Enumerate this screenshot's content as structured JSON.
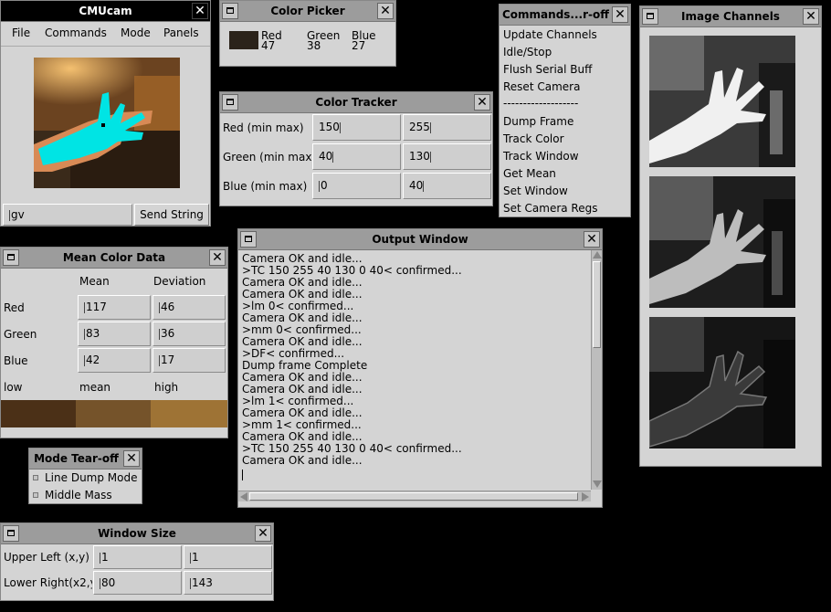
{
  "cmucam": {
    "title": "CMUcam",
    "menu": [
      "File",
      "Commands",
      "Mode",
      "Panels"
    ],
    "command_input": "gv",
    "send_button": "Send String"
  },
  "color_picker": {
    "title": "Color Picker",
    "swatch_color": "#2b231a",
    "channels": [
      {
        "label": "Red",
        "value": "47"
      },
      {
        "label": "Green",
        "value": "38"
      },
      {
        "label": "Blue",
        "value": "27"
      }
    ]
  },
  "color_tracker": {
    "title": "Color Tracker",
    "rows": [
      {
        "label": "Red (min max)",
        "min": "150",
        "max": "255"
      },
      {
        "label": "Green (min max",
        "min": "40",
        "max": "130"
      },
      {
        "label": "Blue (min max)",
        "min": "0",
        "max": "40"
      }
    ]
  },
  "commands_tearoff": {
    "title": "Commands...r-off",
    "items": [
      "Update Channels",
      "Idle/Stop",
      "Flush Serial Buff",
      "Reset Camera"
    ],
    "separator": "-------------------",
    "items2": [
      "Dump Frame",
      "Track Color",
      "Track Window",
      "Get Mean",
      "Set Window",
      "Set Camera Regs"
    ]
  },
  "image_channels": {
    "title": "Image Channels"
  },
  "mean_color": {
    "title": "Mean Color Data",
    "col_mean": "Mean",
    "col_dev": "Deviation",
    "rows": [
      {
        "label": "Red",
        "mean": "117",
        "dev": "46"
      },
      {
        "label": "Green",
        "mean": "83",
        "dev": "36"
      },
      {
        "label": "Blue",
        "mean": "42",
        "dev": "17"
      }
    ],
    "swatch_labels": [
      "low",
      "mean",
      "high"
    ],
    "swatch_colors": [
      "#4b3017",
      "#75532a",
      "#9e7335"
    ]
  },
  "output_window": {
    "title": "Output Window",
    "lines": [
      "Camera OK and idle...",
      ">TC 150 255 40 130 0 40< confirmed...",
      "Camera OK and idle...",
      "Camera OK and idle...",
      ">lm 0< confirmed...",
      "Camera OK and idle...",
      ">mm 0< confirmed...",
      "Camera OK and idle...",
      ">DF< confirmed...",
      "Dump frame Complete",
      "Camera OK and idle...",
      "Camera OK and idle...",
      ">lm 1< confirmed...",
      "Camera OK and idle...",
      ">mm 1< confirmed...",
      "Camera OK and idle...",
      ">TC 150 255 40 130 0 40< confirmed...",
      "Camera OK and idle..."
    ]
  },
  "mode_tearoff": {
    "title": "Mode Tear-off",
    "options": [
      "Line Dump Mode",
      "Middle Mass"
    ]
  },
  "window_size": {
    "title": "Window Size",
    "rows": [
      {
        "label": "Upper Left (x,y)",
        "a": "1",
        "b": "1"
      },
      {
        "label": "Lower Right(x2,y",
        "a": "80",
        "b": "143"
      }
    ]
  }
}
